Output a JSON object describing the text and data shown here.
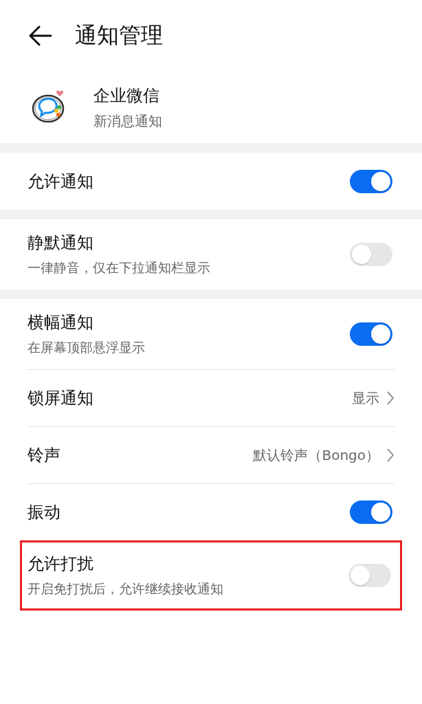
{
  "header": {
    "title": "通知管理"
  },
  "app": {
    "name": "企业微信",
    "subtitle": "新消息通知"
  },
  "sections": [
    {
      "items": [
        {
          "kind": "toggle",
          "label": "允许通知",
          "on": true,
          "highlighted": false
        }
      ]
    },
    {
      "items": [
        {
          "kind": "toggle",
          "label": "静默通知",
          "subtitle": "一律静音，仅在下拉通知栏显示",
          "on": false,
          "highlighted": false
        }
      ]
    },
    {
      "items": [
        {
          "kind": "toggle",
          "label": "横幅通知",
          "subtitle": "在屏幕顶部悬浮显示",
          "on": true,
          "highlighted": false
        },
        {
          "kind": "link",
          "label": "锁屏通知",
          "value": "显示",
          "highlighted": false
        },
        {
          "kind": "link",
          "label": "铃声",
          "value": "默认铃声（Bongo）",
          "highlighted": false
        },
        {
          "kind": "toggle",
          "label": "振动",
          "on": true,
          "highlighted": false
        },
        {
          "kind": "toggle",
          "label": "允许打扰",
          "subtitle": "开启免打扰后，允许继续接收通知",
          "on": false,
          "highlighted": true
        }
      ]
    }
  ]
}
